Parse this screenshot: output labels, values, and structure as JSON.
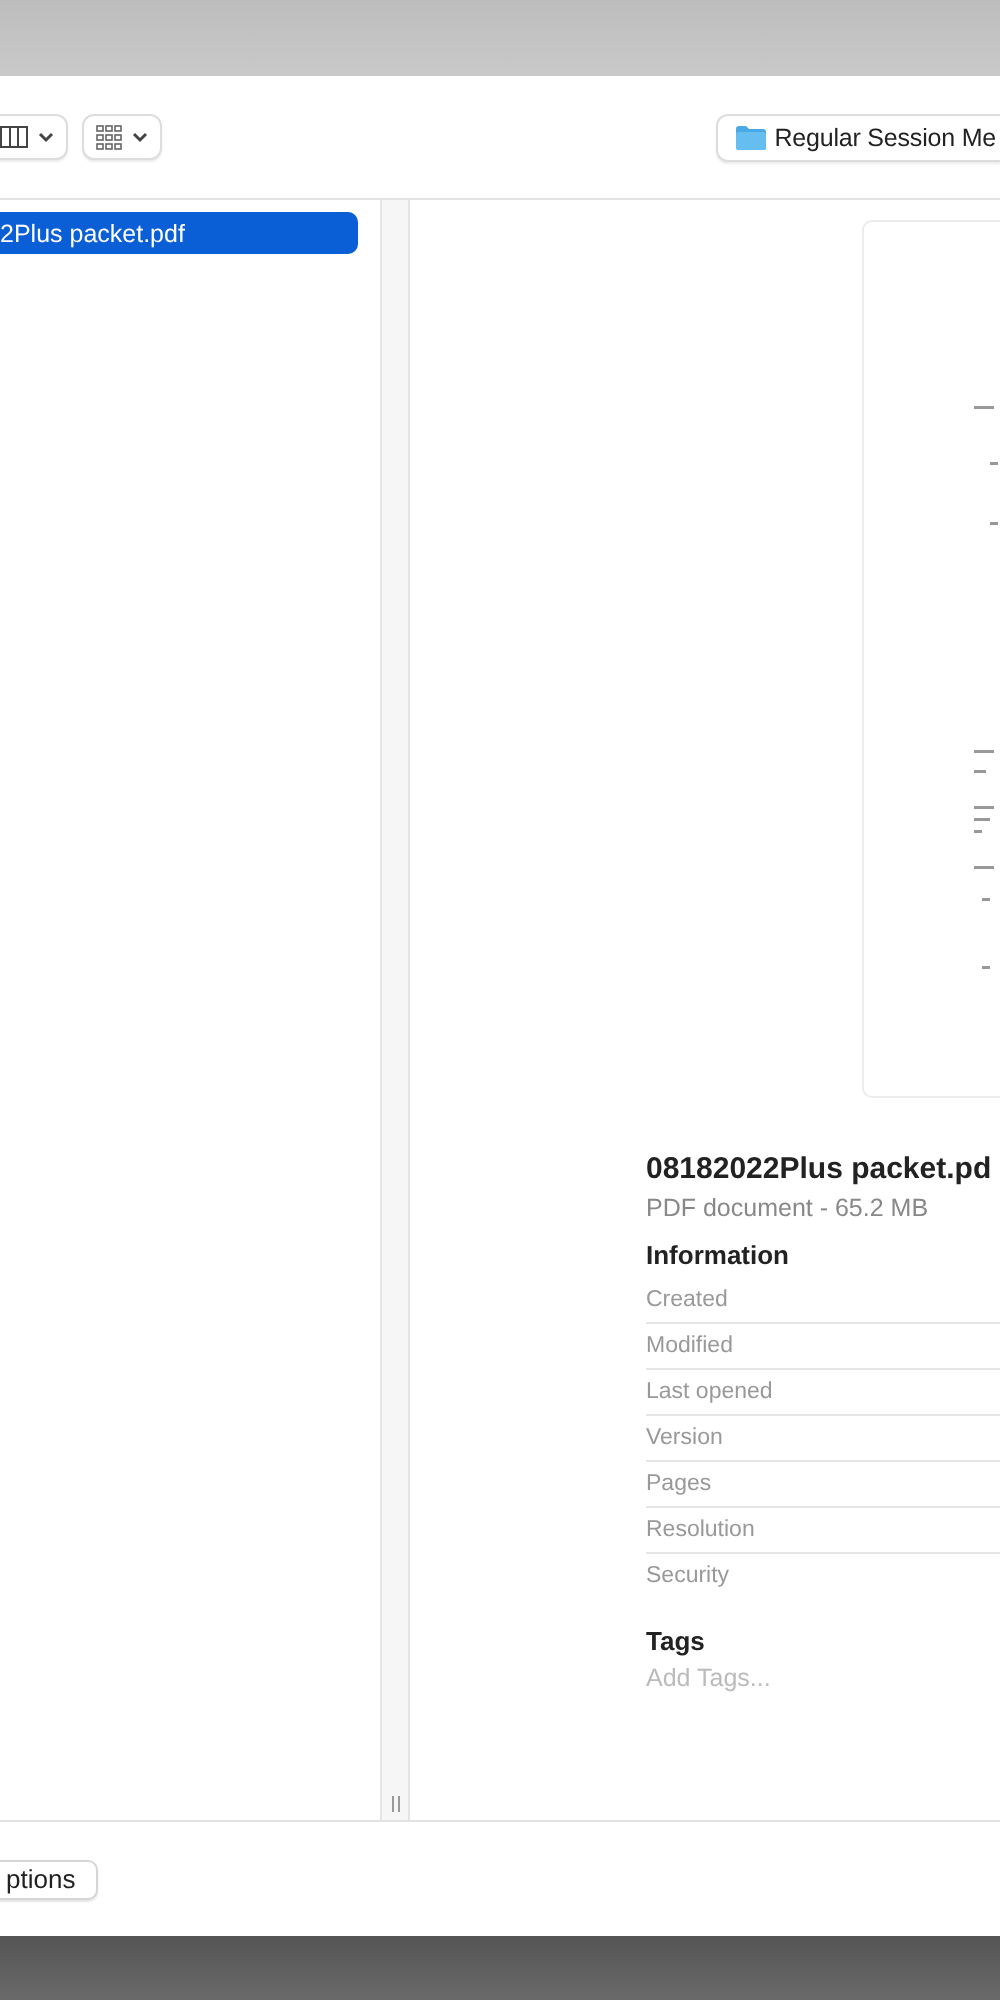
{
  "toolbar": {
    "view_buttons": [
      {
        "kind": "columns"
      },
      {
        "kind": "grid"
      }
    ],
    "location": "Regular Session Me"
  },
  "file_list": [
    {
      "name": "2Plus packet.pdf",
      "selected": true
    }
  ],
  "preview": {
    "title": "08182022Plus packet.pd",
    "subtitle": "PDF document - 65.2 MB",
    "information_heading": "Information",
    "information_rows": [
      "Created",
      "Modified",
      "Last opened",
      "Version",
      "Pages",
      "Resolution",
      "Security"
    ],
    "tags_heading": "Tags",
    "tags_placeholder": "Add Tags..."
  },
  "footer": {
    "button": "ptions"
  }
}
